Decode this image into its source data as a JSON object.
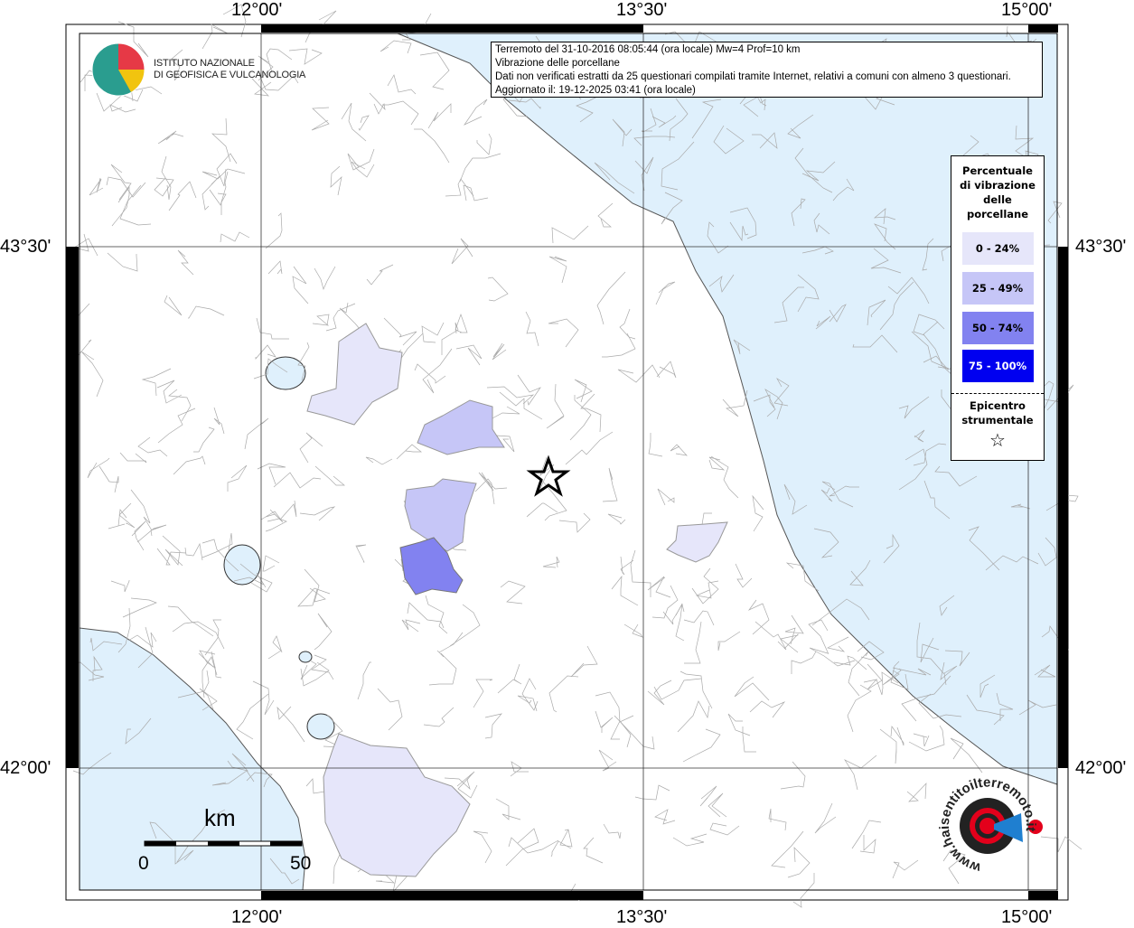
{
  "info": {
    "line1": "Terremoto del 31-10-2016 08:05:44 (ora locale) Mw=4 Prof=10 km",
    "line2": "Vibrazione delle porcellane",
    "line3": "Dati non verificati estratti da 25 questionari compilati tramite Internet, relativi a comuni con almeno 3 questionari.",
    "line4": "Aggiornato il: 19-12-2025 03:41 (ora locale)"
  },
  "logo_ingv": {
    "line1": "ISTITUTO NAZIONALE",
    "line2": "DI GEOFISICA E VULCANOLOGIA"
  },
  "logo_hsit": {
    "text": "www.haisentitoilterremoto.it"
  },
  "axes": {
    "lon_labels": [
      "12°00'",
      "13°30'",
      "15°00'"
    ],
    "lat_labels": [
      "43°30'",
      "42°00'"
    ]
  },
  "legend": {
    "title": [
      "Percentuale",
      "di vibrazione",
      "delle",
      "porcellane"
    ],
    "classes": [
      {
        "label": "0 - 24%",
        "color": "#e6e6fa"
      },
      {
        "label": "25 - 49%",
        "color": "#c6c6f7"
      },
      {
        "label": "50 - 74%",
        "color": "#8282f0"
      },
      {
        "label": "75 - 100%",
        "color": "#0000f0"
      }
    ],
    "epicenter_label": [
      "Epicentro",
      "strumentale"
    ],
    "epicenter_symbol": "☆"
  },
  "scale": {
    "unit": "km",
    "min": "0",
    "max": "50"
  },
  "colors": {
    "sea": "#dff0fc",
    "land": "#ffffff",
    "border": "#999999"
  }
}
